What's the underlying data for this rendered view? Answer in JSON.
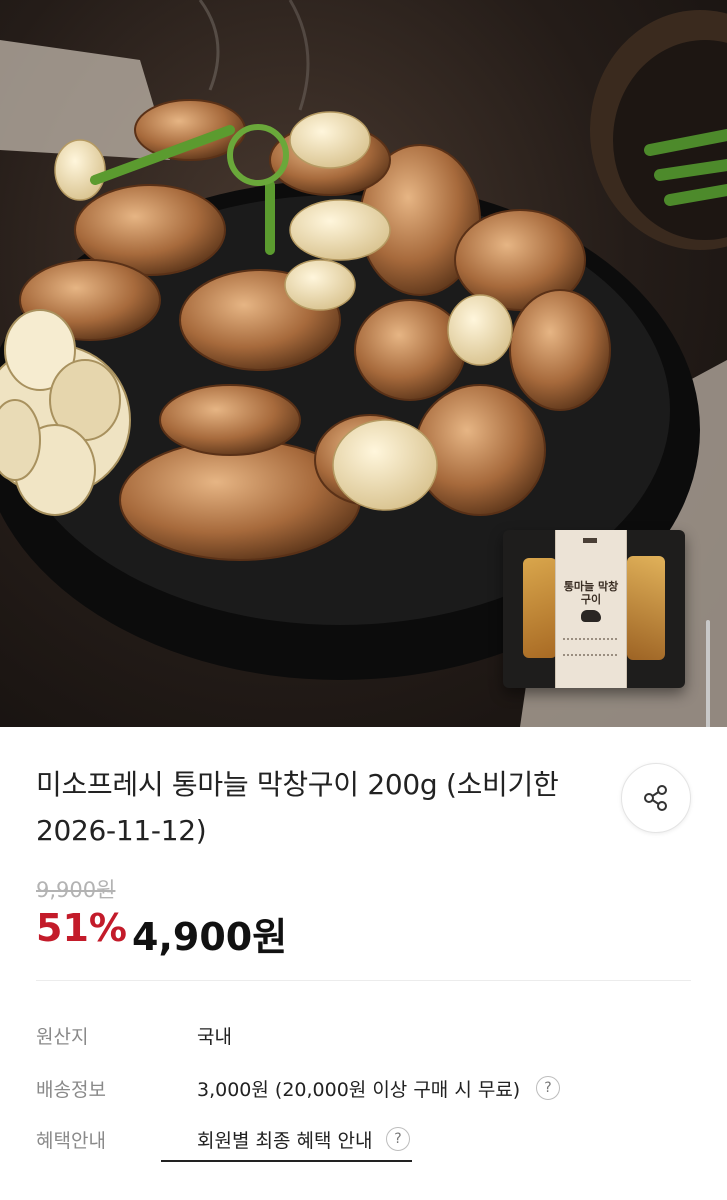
{
  "product": {
    "title": "미소프레시 통마늘 막창구이 200g (소비기한 2026-11-12)",
    "original_price": "9,900원",
    "discount_rate": "51%",
    "sale_price": "4,900원",
    "package_label": "통마늘 막창구이"
  },
  "info": {
    "origin_label": "원산지",
    "origin_value": "국내",
    "shipping_label": "배송정보",
    "shipping_value": "3,000원 (20,000원 이상 구매 시 무료)",
    "benefit_label": "혜택안내",
    "benefit_value": "회원별 최종 혜택 안내"
  },
  "icons": {
    "share": "share-icon",
    "help": "question-circle-icon"
  },
  "colors": {
    "discount": "#c31b2a",
    "price": "#111111",
    "label": "#8a8a8a"
  }
}
